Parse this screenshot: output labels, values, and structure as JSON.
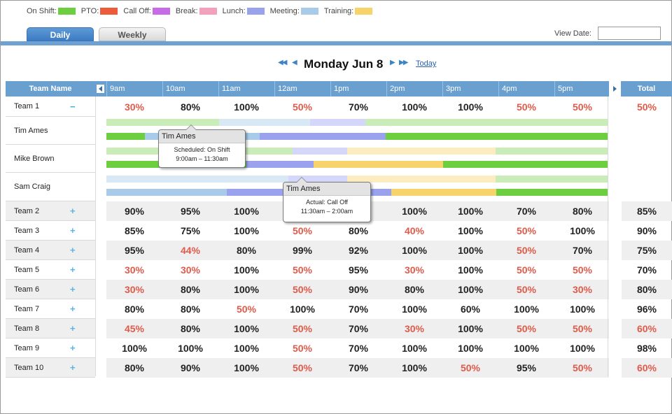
{
  "legend": [
    {
      "label": "On Shift:",
      "color": "#6dcf3f"
    },
    {
      "label": "PTO:",
      "color": "#ee5a3c"
    },
    {
      "label": "Call Off:",
      "color": "#c86be6"
    },
    {
      "label": "Break:",
      "color": "#f3a0bc"
    },
    {
      "label": "Lunch:",
      "color": "#9aa2ee"
    },
    {
      "label": "Meeting:",
      "color": "#a7cbe8"
    },
    {
      "label": "Training:",
      "color": "#f6d46b"
    }
  ],
  "tabs": {
    "daily": "Daily",
    "weekly": "Weekly"
  },
  "view_date": {
    "label": "View Date:",
    "value": ""
  },
  "date_nav": {
    "title": "Monday Jun 8",
    "today": "Today"
  },
  "header": {
    "team_name": "Team Name",
    "hours": [
      "9am",
      "10am",
      "11am",
      "12am",
      "1pm",
      "2pm",
      "3pm",
      "4pm",
      "5pm"
    ],
    "total": "Total"
  },
  "team1": {
    "name": "Team 1",
    "toggle": "−",
    "values": [
      "30%",
      "80%",
      "100%",
      "50%",
      "70%",
      "100%",
      "100%",
      "50%",
      "50%"
    ],
    "total": "50%",
    "red": [
      true,
      false,
      false,
      true,
      false,
      false,
      false,
      true,
      true
    ],
    "total_red": true
  },
  "members": [
    "Tim Ames",
    "Mike Brown",
    "Sam Craig"
  ],
  "teams": [
    {
      "name": "Team 2",
      "toggle": "+",
      "values": [
        "90%",
        "95%",
        "100%",
        "",
        "",
        "100%",
        "100%",
        "70%",
        "80%"
      ],
      "red": [
        false,
        false,
        false,
        false,
        false,
        false,
        false,
        false,
        false
      ],
      "total": "85%",
      "total_red": false
    },
    {
      "name": "Team 3",
      "toggle": "+",
      "values": [
        "85%",
        "75%",
        "100%",
        "50%",
        "80%",
        "40%",
        "100%",
        "50%",
        "100%"
      ],
      "red": [
        false,
        false,
        false,
        true,
        false,
        true,
        false,
        true,
        false
      ],
      "total": "90%",
      "total_red": false
    },
    {
      "name": "Team 4",
      "toggle": "+",
      "values": [
        "95%",
        "44%",
        "80%",
        "99%",
        "92%",
        "100%",
        "100%",
        "50%",
        "70%"
      ],
      "red": [
        false,
        true,
        false,
        false,
        false,
        false,
        false,
        true,
        false
      ],
      "total": "75%",
      "total_red": false
    },
    {
      "name": "Team 5",
      "toggle": "+",
      "values": [
        "30%",
        "30%",
        "100%",
        "50%",
        "95%",
        "30%",
        "100%",
        "50%",
        "50%"
      ],
      "red": [
        true,
        true,
        false,
        true,
        false,
        true,
        false,
        true,
        true
      ],
      "total": "70%",
      "total_red": false
    },
    {
      "name": "Team 6",
      "toggle": "+",
      "values": [
        "30%",
        "80%",
        "100%",
        "50%",
        "90%",
        "80%",
        "100%",
        "50%",
        "30%"
      ],
      "red": [
        true,
        false,
        false,
        true,
        false,
        false,
        false,
        true,
        true
      ],
      "total": "80%",
      "total_red": false
    },
    {
      "name": "Team 7",
      "toggle": "+",
      "values": [
        "80%",
        "80%",
        "50%",
        "100%",
        "70%",
        "100%",
        "60%",
        "100%",
        "100%"
      ],
      "red": [
        false,
        false,
        true,
        false,
        false,
        false,
        false,
        false,
        false
      ],
      "total": "96%",
      "total_red": false
    },
    {
      "name": "Team 8",
      "toggle": "+",
      "values": [
        "45%",
        "80%",
        "100%",
        "50%",
        "70%",
        "30%",
        "100%",
        "50%",
        "50%"
      ],
      "red": [
        true,
        false,
        false,
        true,
        false,
        true,
        false,
        true,
        true
      ],
      "total": "60%",
      "total_red": true
    },
    {
      "name": "Team 9",
      "toggle": "+",
      "values": [
        "100%",
        "100%",
        "100%",
        "50%",
        "70%",
        "100%",
        "100%",
        "100%",
        "100%"
      ],
      "red": [
        false,
        false,
        false,
        true,
        false,
        false,
        false,
        false,
        false
      ],
      "total": "98%",
      "total_red": false
    },
    {
      "name": "Team 10",
      "toggle": "+",
      "values": [
        "80%",
        "90%",
        "100%",
        "50%",
        "70%",
        "100%",
        "50%",
        "95%",
        "50%"
      ],
      "red": [
        false,
        false,
        false,
        true,
        false,
        false,
        true,
        false,
        true
      ],
      "total": "60%",
      "total_red": true
    }
  ],
  "tooltips": [
    {
      "name": "Tim Ames",
      "line1": "Scheduled: On Shift",
      "line2": "9:00am – 11:30am"
    },
    {
      "name": "Tim Ames",
      "line1": "Actual: Call Off",
      "line2": "11:30am – 2:00am"
    }
  ]
}
